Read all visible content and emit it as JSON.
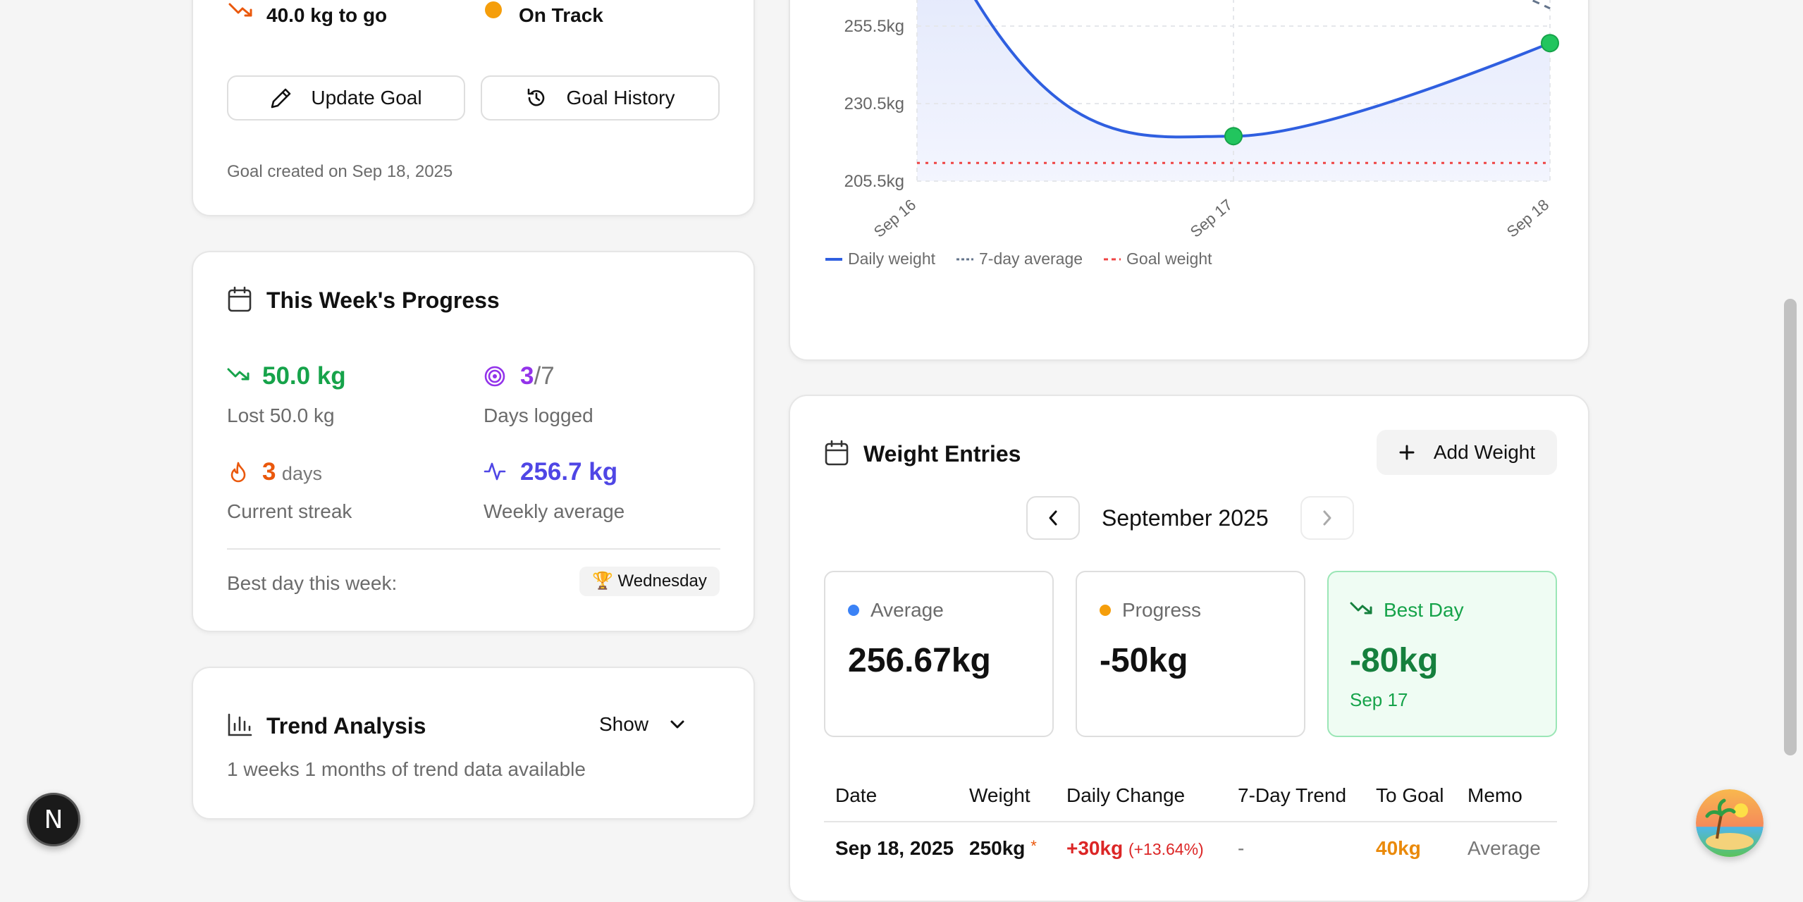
{
  "goal_card": {
    "remaining": "40.0 kg to go",
    "status": "On Track",
    "update_btn": "Update Goal",
    "history_btn": "Goal History",
    "created": "Goal created on Sep 18, 2025"
  },
  "week": {
    "title": "This Week's Progress",
    "lost_value": "50.0 kg",
    "lost_label": "Lost 50.0 kg",
    "days_value": "3",
    "days_total": "/7",
    "days_label": "Days logged",
    "streak_value": "3",
    "streak_unit": "days",
    "streak_label": "Current streak",
    "avg_value": "256.7 kg",
    "avg_label": "Weekly average",
    "best_day_label": "Best day this week:",
    "best_day_value": "🏆 Wednesday"
  },
  "trend": {
    "title": "Trend Analysis",
    "toggle": "Show",
    "summary": "1 weeks 1 months of trend data available"
  },
  "chart": {
    "legend": [
      "Daily weight",
      "7-day average",
      "Goal weight"
    ],
    "colors": {
      "daily": "#2f5fe0",
      "average": "#64748b",
      "goal": "#ef4444",
      "point": "#22c55e"
    }
  },
  "chart_data": {
    "type": "line",
    "x": [
      "Sep 16",
      "Sep 17",
      "Sep 18"
    ],
    "yticks": [
      "205.5kg",
      "230.5kg",
      "255.5kg"
    ],
    "series": [
      {
        "name": "Daily weight",
        "values": [
          300,
          220,
          250
        ]
      },
      {
        "name": "7-day average",
        "values": [
          300,
          260,
          256.67
        ]
      },
      {
        "name": "Goal weight",
        "values": [
          210,
          210,
          210
        ]
      }
    ]
  },
  "entries": {
    "title": "Weight Entries",
    "add_btn": "Add Weight",
    "month": "September 2025",
    "stats": [
      {
        "label": "Average",
        "value": "256.67kg"
      },
      {
        "label": "Progress",
        "value": "-50kg"
      },
      {
        "label": "Best Day",
        "value": "-80kg",
        "sub": "Sep 17"
      }
    ],
    "columns": [
      "Date",
      "Weight",
      "Daily Change",
      "7-Day Trend",
      "To Goal",
      "Memo"
    ],
    "rows": [
      {
        "date": "Sep 18, 2025",
        "weight": "250kg",
        "marker": "*",
        "change": "+30kg",
        "change_pct": "(+13.64%)",
        "trend": "-",
        "to_goal": "40kg",
        "memo": "Average"
      }
    ]
  },
  "floating": {
    "next_badge": "N"
  }
}
